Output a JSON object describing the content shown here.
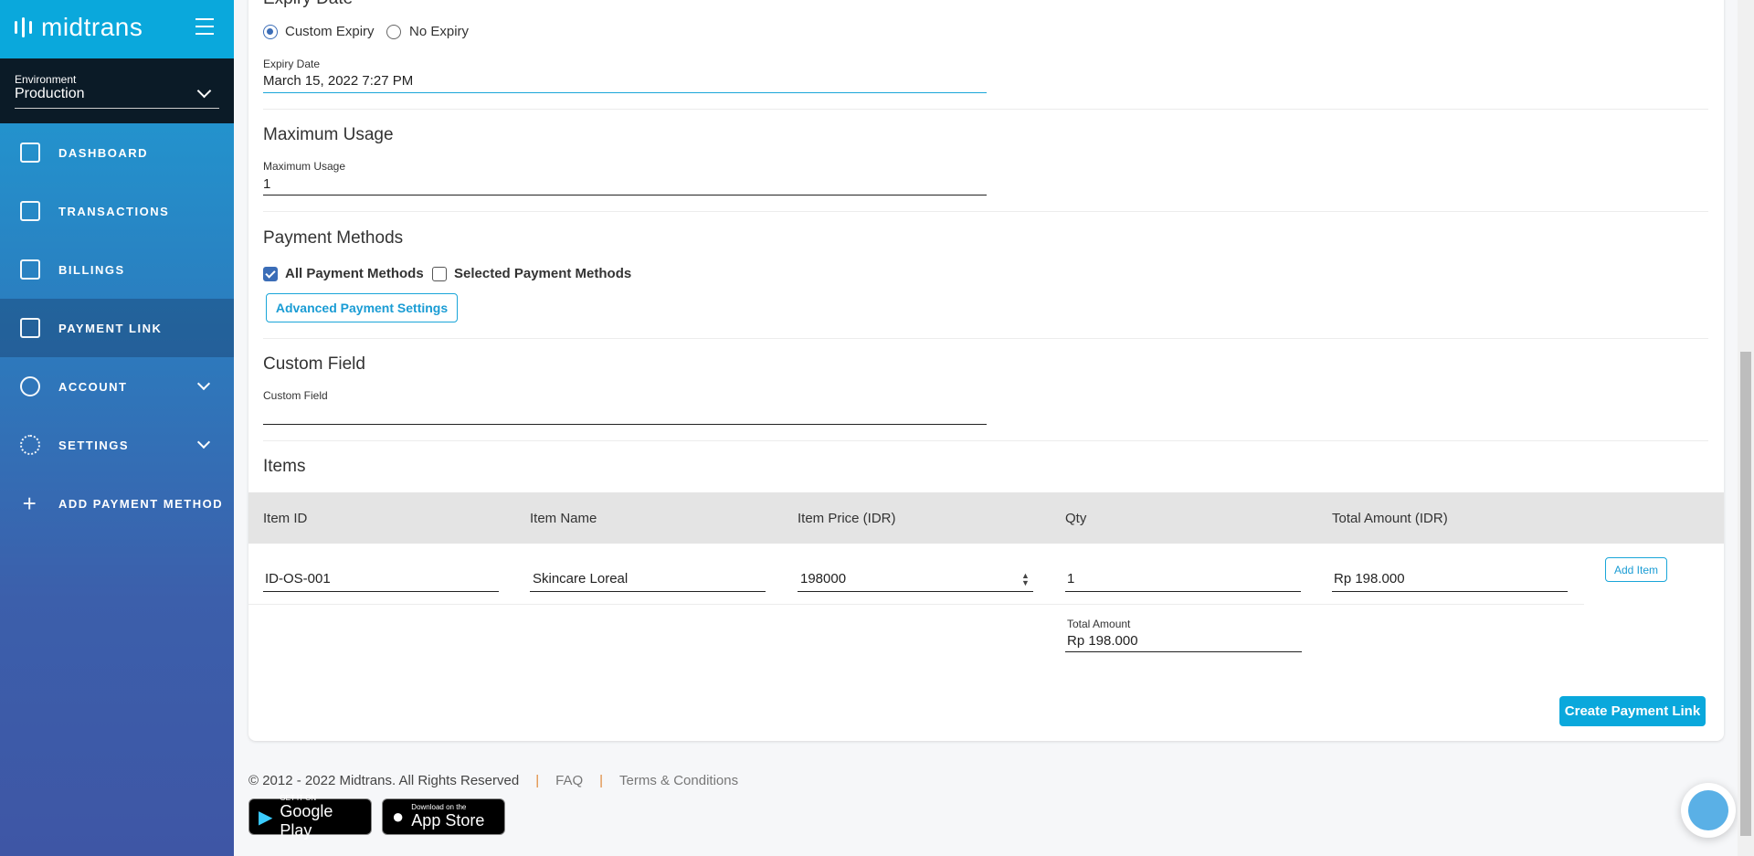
{
  "sidebar": {
    "logo": "midtrans",
    "environment_label": "Environment",
    "environment_value": "Production",
    "items": [
      {
        "label": "DASHBOARD"
      },
      {
        "label": "TRANSACTIONS"
      },
      {
        "label": "BILLINGS"
      },
      {
        "label": "PAYMENT LINK",
        "active": true
      },
      {
        "label": "ACCOUNT"
      },
      {
        "label": "SETTINGS"
      },
      {
        "label": "ADD PAYMENT METHOD"
      }
    ]
  },
  "form": {
    "expiry": {
      "heading": "Expiry Date",
      "options": [
        "Custom Expiry",
        "No Expiry"
      ],
      "selected": "Custom Expiry",
      "field_label": "Expiry Date",
      "field_value": "March 15, 2022 7:27 PM"
    },
    "max_usage": {
      "heading": "Maximum Usage",
      "field_label": "Maximum Usage",
      "field_value": "1"
    },
    "payment_methods": {
      "heading": "Payment Methods",
      "all_label": "All Payment Methods",
      "all_checked": true,
      "selected_label": "Selected Payment Methods",
      "selected_checked": false,
      "advanced_button": "Advanced Payment Settings"
    },
    "custom_field": {
      "heading": "Custom Field",
      "field_label": "Custom Field",
      "field_value": ""
    },
    "items": {
      "heading": "Items",
      "columns": [
        "Item ID",
        "Item Name",
        "Item Price (IDR)",
        "Qty",
        "Total Amount (IDR)"
      ],
      "rows": [
        {
          "id": "ID-OS-001",
          "name": "Skincare Loreal",
          "price": "198000",
          "qty": "1",
          "total": "Rp 198.000"
        }
      ],
      "add_item": "Add Item",
      "total_label": "Total Amount",
      "total_value": "Rp 198.000"
    },
    "create_button": "Create Payment Link"
  },
  "footer": {
    "copyright": "© 2012 - 2022 Midtrans. All Rights Reserved",
    "sep": "|",
    "faq": "FAQ",
    "terms": "Terms & Conditions",
    "google_play_small": "GET IT ON",
    "google_play": "Google Play",
    "app_store_small": "Download on the",
    "app_store": "App Store"
  },
  "colors": {
    "accent": "#0aa8dc",
    "sidebar_dark": "#0b1b27",
    "checkbox": "#3b6db7"
  }
}
